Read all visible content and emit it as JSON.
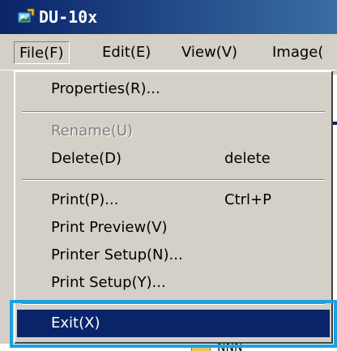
{
  "window": {
    "title": "DU-10x",
    "title_color": "#ffffff",
    "titlebar_color": "#0a246a",
    "app_icon": "app-icon"
  },
  "menubar": {
    "items": [
      {
        "label": "File(F)",
        "open": true
      },
      {
        "label": "Edit(E)"
      },
      {
        "label": "View(V)"
      },
      {
        "label": "Image("
      }
    ]
  },
  "file_menu": {
    "items": [
      {
        "label": "Properties(R)...",
        "shortcut": "",
        "enabled": true
      },
      {
        "separator": true
      },
      {
        "label": "Rename(U)",
        "shortcut": "",
        "enabled": false
      },
      {
        "label": "Delete(D)",
        "shortcut": "delete",
        "enabled": true
      },
      {
        "separator": true
      },
      {
        "label": "Print(P)...",
        "shortcut": "Ctrl+P",
        "enabled": true
      },
      {
        "label": "Print Preview(V)",
        "shortcut": "",
        "enabled": true
      },
      {
        "label": "Printer Setup(N)...",
        "shortcut": "",
        "enabled": true
      },
      {
        "label": "Print Setup(Y)...",
        "shortcut": "",
        "enabled": true
      },
      {
        "separator": true
      },
      {
        "label": "Exit(X)",
        "shortcut": "",
        "enabled": true,
        "selected": true
      }
    ],
    "selection_color": "#0a246a",
    "highlight_box_color": "#1ba1e2"
  },
  "background": {
    "partial_text": "NNN"
  }
}
